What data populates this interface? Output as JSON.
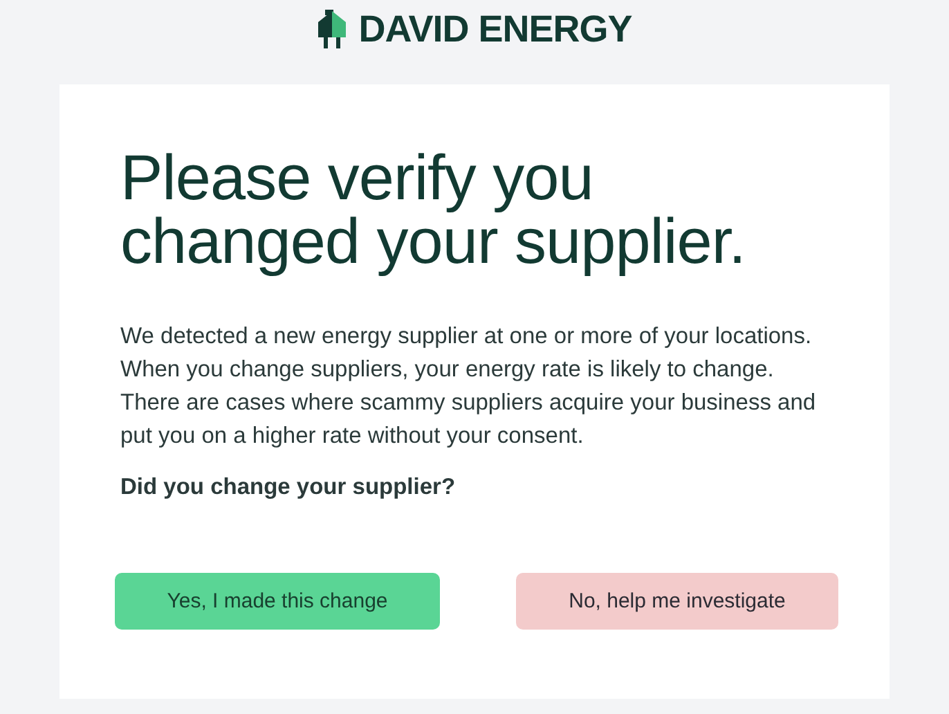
{
  "brand": {
    "name": "DAVID ENERGY"
  },
  "card": {
    "heading": "Please verify you changed your supplier.",
    "body": "We detected a new energy supplier at one or more of your locations. When you change suppliers, your energy rate is likely to change. There are cases where scammy suppliers acquire your business and put you on a higher rate without your consent.",
    "question": "Did you change your supplier?",
    "buttons": [
      {
        "label": "Yes, I made this change",
        "kind": "confirm"
      },
      {
        "label": "No, help me investigate",
        "kind": "deny"
      }
    ]
  }
}
